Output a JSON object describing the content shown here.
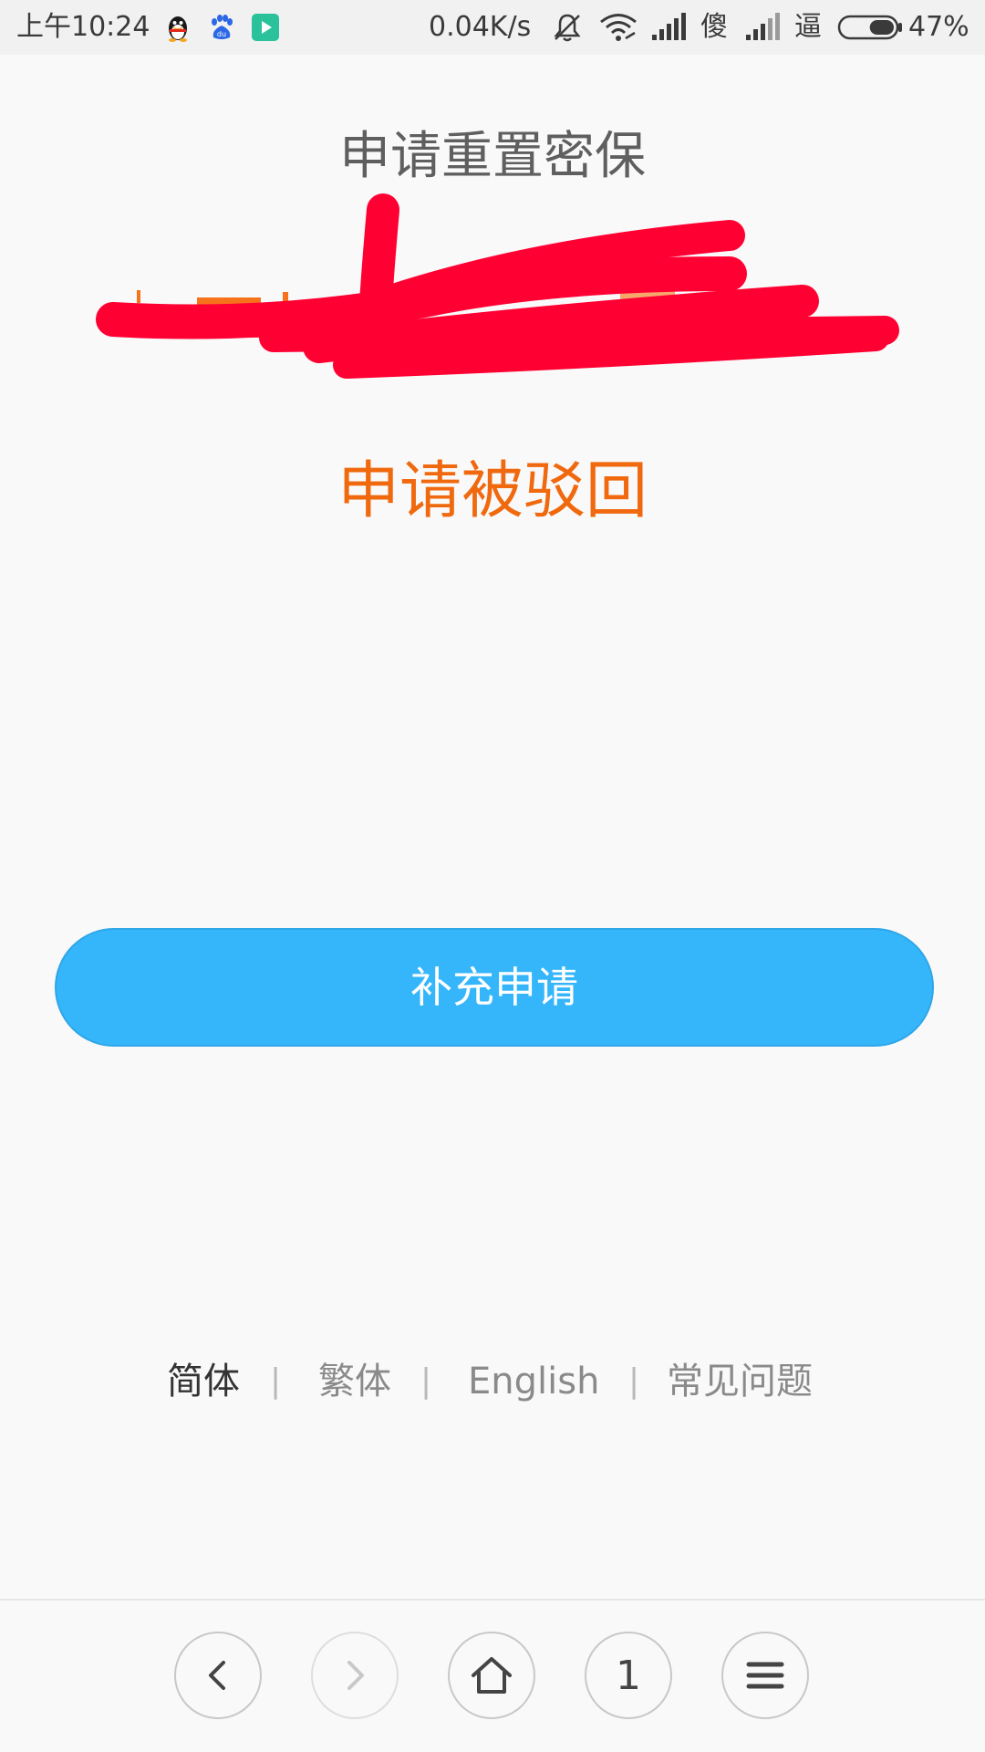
{
  "status_bar": {
    "time": "上午10:24",
    "notification_icons": [
      "qq-icon",
      "baidu-icon",
      "play-icon"
    ],
    "net_speed": "0.04K/s",
    "carrier_1": "傻",
    "carrier_2": "逼",
    "battery_percent": "47%",
    "battery_level": 0.47
  },
  "page": {
    "title": "申请重置密保",
    "status_message": "申请被驳回",
    "redacted_hint": "redacted-scribble"
  },
  "actions": {
    "supplement_label": "补充申请"
  },
  "language_links": {
    "simplified": "简体",
    "traditional": "繁体",
    "english": "English",
    "faq": "常见问题",
    "separator": "|"
  },
  "browser_nav": {
    "tab_count": "1",
    "icons": [
      "back-icon",
      "forward-icon",
      "home-icon",
      "tabs-icon",
      "menu-icon"
    ]
  },
  "colors": {
    "accent_button": "#35b6fb",
    "status_orange": "#f0690e",
    "scribble_red": "#ff0033"
  }
}
